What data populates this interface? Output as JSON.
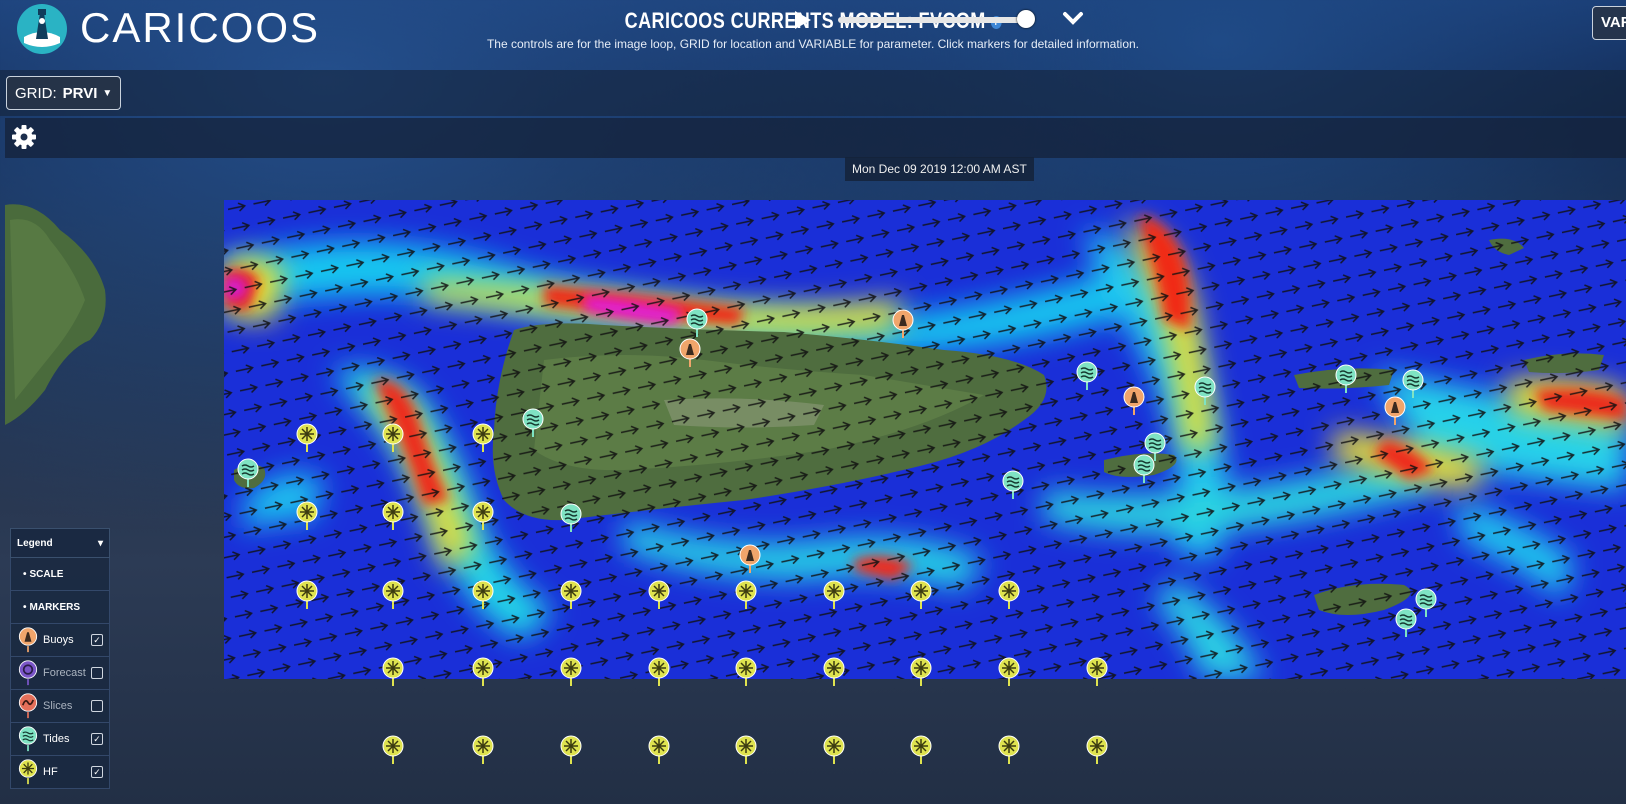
{
  "header": {
    "logo_text": "CARICOOS",
    "title": "CARICOOS CURRENTS MODEL: FVCOM",
    "subtitle": "The controls are for the image loop, GRID for location and VARIABLE for parameter. Click markers for detailed information."
  },
  "grid_control": {
    "label": "GRID:",
    "value": "PRVI"
  },
  "variable_control": {
    "label": "VAR"
  },
  "animation": {
    "timestamp": "Mon Dec 09 2019 12:00 AM AST",
    "slider_position": 0.95
  },
  "legend": {
    "title": "Legend",
    "sections": [
      "SCALE",
      "MARKERS"
    ],
    "items": [
      {
        "label": "Buoys",
        "checked": true,
        "icon": "buoy-icon",
        "color": "#f0a56b"
      },
      {
        "label": "Forecast",
        "checked": false,
        "icon": "forecast-icon",
        "color": "#7a55c8"
      },
      {
        "label": "Slices",
        "checked": false,
        "icon": "slices-icon",
        "color": "#e46f5a"
      },
      {
        "label": "Tides",
        "checked": true,
        "icon": "tides-icon",
        "color": "#7fe3c3"
      },
      {
        "label": "HF",
        "checked": true,
        "icon": "hf-radar-icon",
        "color": "#dfe34f"
      }
    ]
  },
  "markers": {
    "buoys": [
      [
        690,
        352
      ],
      [
        903,
        323
      ],
      [
        1134,
        400
      ],
      [
        1395,
        410
      ],
      [
        750,
        558
      ]
    ],
    "tides": [
      [
        697,
        322
      ],
      [
        533,
        422
      ],
      [
        248,
        472
      ],
      [
        571,
        517
      ],
      [
        1087,
        375
      ],
      [
        1205,
        390
      ],
      [
        1413,
        383
      ],
      [
        1155,
        446
      ],
      [
        1144,
        468
      ],
      [
        1013,
        484
      ],
      [
        1346,
        378
      ],
      [
        1426,
        602
      ],
      [
        1406,
        622
      ]
    ],
    "hf": [
      [
        307,
        437
      ],
      [
        393,
        437
      ],
      [
        483,
        437
      ],
      [
        307,
        515
      ],
      [
        393,
        515
      ],
      [
        483,
        515
      ],
      [
        307,
        594
      ],
      [
        393,
        594
      ],
      [
        483,
        594
      ],
      [
        571,
        594
      ],
      [
        659,
        594
      ],
      [
        746,
        594
      ],
      [
        834,
        594
      ],
      [
        921,
        594
      ],
      [
        1009,
        594
      ],
      [
        393,
        671
      ],
      [
        483,
        671
      ],
      [
        571,
        671
      ],
      [
        659,
        671
      ],
      [
        746,
        671
      ],
      [
        834,
        671
      ],
      [
        921,
        671
      ],
      [
        1009,
        671
      ],
      [
        1097,
        671
      ],
      [
        393,
        749
      ],
      [
        483,
        749
      ],
      [
        571,
        749
      ],
      [
        659,
        749
      ],
      [
        746,
        749
      ],
      [
        834,
        749
      ],
      [
        921,
        749
      ],
      [
        1009,
        749
      ],
      [
        1097,
        749
      ]
    ]
  },
  "colors": {
    "buoy": "#f0a56b",
    "tide": "#7fe3c3",
    "hf": "#dfe34f"
  }
}
